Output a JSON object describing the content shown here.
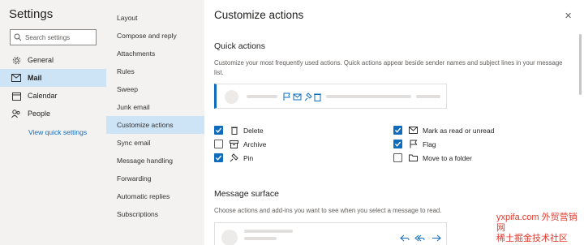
{
  "settings": {
    "title": "Settings",
    "search_placeholder": "Search settings"
  },
  "nav": [
    {
      "label": "General",
      "icon": "gear-icon"
    },
    {
      "label": "Mail",
      "icon": "mail-icon",
      "active": true
    },
    {
      "label": "Calendar",
      "icon": "calendar-icon"
    },
    {
      "label": "People",
      "icon": "people-icon"
    }
  ],
  "quick_settings_link": "View quick settings",
  "subnav": [
    "Layout",
    "Compose and reply",
    "Attachments",
    "Rules",
    "Sweep",
    "Junk email",
    "Customize actions",
    "Sync email",
    "Message handling",
    "Forwarding",
    "Automatic replies",
    "Subscriptions"
  ],
  "subnav_active": "Customize actions",
  "panel": {
    "title": "Customize actions",
    "quick_actions": {
      "title": "Quick actions",
      "description": "Customize your most frequently used actions. Quick actions appear beside sender names and subject lines in your message list."
    },
    "checkboxes": [
      {
        "label": "Delete",
        "checked": true,
        "icon": "trash-icon"
      },
      {
        "label": "Archive",
        "checked": false,
        "icon": "archive-icon"
      },
      {
        "label": "Pin",
        "checked": true,
        "icon": "pin-icon"
      },
      {
        "label": "Mark as read or unread",
        "checked": true,
        "icon": "envelope-icon"
      },
      {
        "label": "Flag",
        "checked": true,
        "icon": "flag-icon"
      },
      {
        "label": "Move to a folder",
        "checked": false,
        "icon": "folder-icon"
      }
    ],
    "message_surface": {
      "title": "Message surface",
      "description": "Choose actions and add-ins you want to see when you select a message to read."
    }
  },
  "watermark": {
    "line1": "稀土掘金技术社区",
    "line2": "yxpifa.com 外贸营销网"
  },
  "colors": {
    "accent": "#0f6cbd",
    "nav_bg": "#f3f2f1",
    "active_bg": "#cde4f7"
  }
}
